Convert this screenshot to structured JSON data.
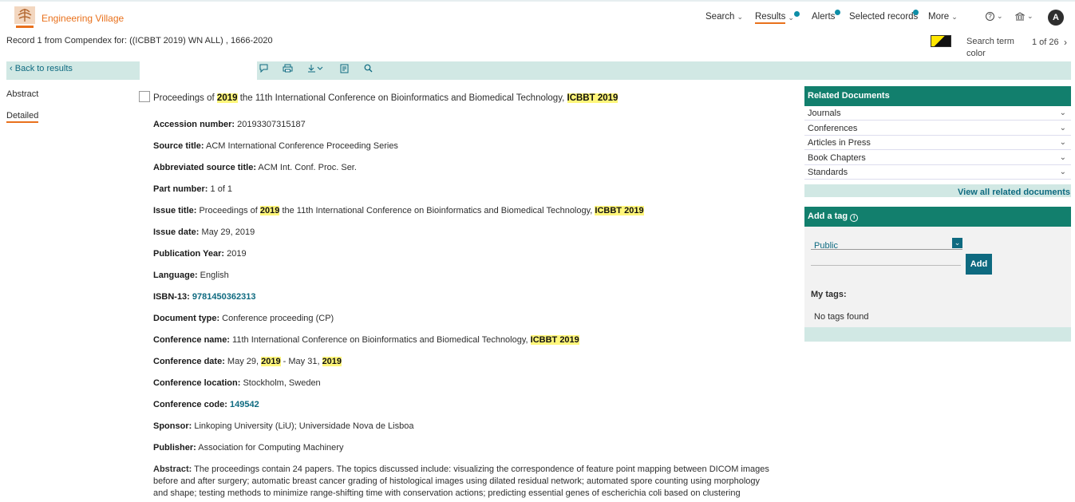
{
  "header": {
    "brand": "Engineering Village",
    "nav": {
      "search": "Search",
      "results": "Results",
      "alerts": "Alerts",
      "selected_records": "Selected records",
      "more": "More",
      "help_icon": "?",
      "avatar_initial": "A"
    }
  },
  "record_info": "Record 1 from Compendex for: ((ICBBT 2019) WN ALL) , 1666-2020",
  "search_term_color_label": "Search term color",
  "pager": "1 of 26",
  "back_to_results": "Back to results",
  "side_tabs": {
    "abstract": "Abstract",
    "detailed": "Detailed"
  },
  "title": {
    "p1": "Proceedings of ",
    "hl1": "2019",
    "p2": " the 11th International Conference on Bioinformatics and Biomedical Technology, ",
    "hl2": "ICBBT 2019"
  },
  "fields": {
    "accession": {
      "label": "Accession number:",
      "value": " 20193307315187"
    },
    "source_title": {
      "label": "Source title:",
      "value": " ACM International Conference Proceeding Series"
    },
    "abbrev_source": {
      "label": "Abbreviated source title:",
      "value": " ACM Int. Conf. Proc. Ser."
    },
    "part_number": {
      "label": "Part number:",
      "value": " 1 of 1"
    },
    "issue_title": {
      "label": "Issue title:",
      "p1": " Proceedings of ",
      "hl1": "2019",
      "p2": " the 11th International Conference on Bioinformatics and Biomedical Technology, ",
      "hl2": "ICBBT 2019"
    },
    "issue_date": {
      "label": "Issue date:",
      "value": " May 29, 2019"
    },
    "pub_year": {
      "label": "Publication Year:",
      "value": " 2019"
    },
    "language": {
      "label": "Language:",
      "value": " English"
    },
    "isbn": {
      "label": "ISBN-13:",
      "value": "9781450362313"
    },
    "doc_type": {
      "label": "Document type:",
      "value": " Conference proceeding (CP)"
    },
    "conf_name": {
      "label": "Conference name:",
      "p1": " 11th International Conference on Bioinformatics and Biomedical Technology, ",
      "hl1": "ICBBT 2019"
    },
    "conf_date": {
      "label": "Conference date:",
      "p1": " May 29, ",
      "hl1": "2019",
      "p2": " - May 31, ",
      "hl2": "2019"
    },
    "conf_location": {
      "label": "Conference location:",
      "value": " Stockholm, Sweden"
    },
    "conf_code": {
      "label": "Conference code:",
      "value": "149542"
    },
    "sponsor": {
      "label": "Sponsor:",
      "value": " Linkoping University (LiU); Universidade Nova de Lisboa"
    },
    "publisher": {
      "label": "Publisher:",
      "value": " Association for Computing Machinery"
    },
    "abstract": {
      "label": "Abstract:",
      "value": " The proceedings contain 24 papers. The topics discussed include: visualizing the correspondence of feature point mapping between DICOM images before and after surgery; automatic breast cancer grading of histological images using dilated residual network; automated spore counting using morphology and shape; testing methods to minimize range-shifting time with conservation actions; predicting essential genes of escherichia coli based on clustering"
    }
  },
  "related": {
    "heading": "Related Documents",
    "items": [
      "Journals",
      "Conferences",
      "Articles in Press",
      "Book Chapters",
      "Standards"
    ],
    "view_all": "View all related documents"
  },
  "tags": {
    "heading": "Add a tag",
    "visibility": "Public",
    "add_button": "Add",
    "my_tags": "My tags:",
    "no_tags": "No tags found"
  },
  "colors": {
    "accent": "#127f6d",
    "link": "#0e6a80",
    "brand": "#e9711c",
    "highlight": "#fff67a"
  }
}
